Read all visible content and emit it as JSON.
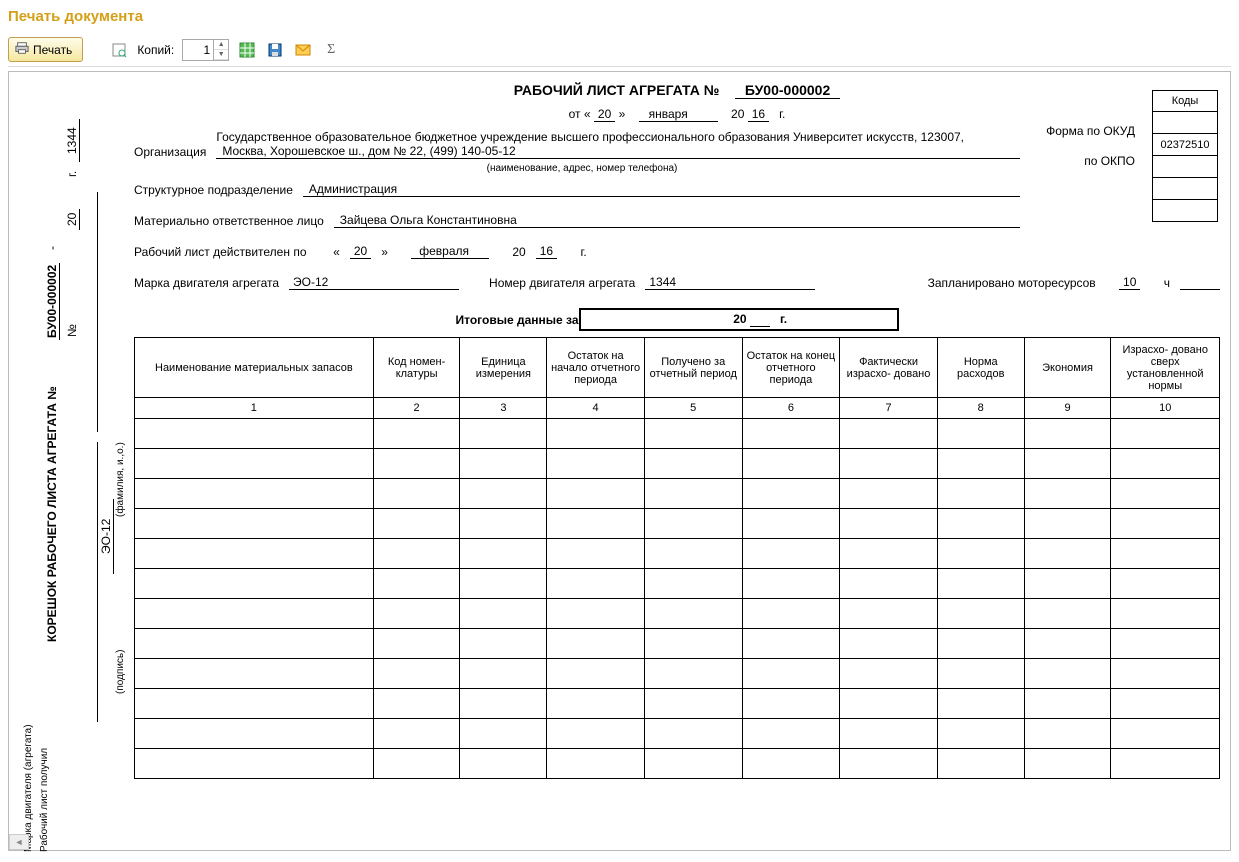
{
  "window": {
    "title": "Печать документа"
  },
  "toolbar": {
    "print_label": "Печать",
    "copies_label": "Копий:",
    "copies_value": "1"
  },
  "doc": {
    "title_prefix": "РАБОЧИЙ  ЛИСТ АГРЕГАТА  №",
    "number": "БУ00-000002",
    "date": {
      "from_prefix": "от  «",
      "day": "20",
      "mid1": "»",
      "month": "января",
      "year_prefix": "20",
      "year": "16",
      "suffix": "г."
    },
    "codes": {
      "header": "Коды",
      "okud_label": "Форма по ОКУД",
      "okud_value": "",
      "okpo_label": "по ОКПО",
      "okpo_value": "02372510"
    },
    "org_label": "Организация",
    "org_value1": "Государственное образовательное бюджетное учреждение высшего профессионального образования  Университет искусств, 123007,",
    "org_value2": "Москва, Хорошевское ш., дом № 22, (499) 140-05-12",
    "org_caption": "(наименование, адрес, номер телефона)",
    "dept_label": "Структурное подразделение",
    "dept_value": "Администрация",
    "person_label": "Материально ответственное лицо",
    "person_value": "Зайцева Ольга Константиновна",
    "valid_label": "Рабочий лист действителен по",
    "valid": {
      "d1": "«",
      "day": "20",
      "d2": "»",
      "month": "февраля",
      "yp": "20",
      "year": "16",
      "suffix": "г."
    },
    "engine_brand_label": "Марка двигателя агрегата",
    "engine_brand": "ЭО-12",
    "engine_num_label": "Номер двигателя агрегата",
    "engine_num": "1344",
    "plan_label": "Запланировано моторесурсов",
    "plan_value": "10",
    "plan_unit": "ч",
    "summary_label": "Итоговые данные за",
    "summary_year_prefix": "20",
    "summary_year_suffix": "г.",
    "table": {
      "headers": [
        "Наименование материальных запасов",
        "Код номен-\nклатуры",
        "Единица измерения",
        "Остаток на начало отчетного периода",
        "Получено за отчетный период",
        "Остаток на конец отчетного периода",
        "Фактически израсхо-\nдовано",
        "Норма расходов",
        "Экономия",
        "Израсхо-\nдовано сверх установленной нормы"
      ],
      "numbers": [
        "1",
        "2",
        "3",
        "4",
        "5",
        "6",
        "7",
        "8",
        "9",
        "10"
      ],
      "empty_rows": 12
    }
  },
  "stub": {
    "title": "КОРЕШОК  РАБОЧЕГО  ЛИСТА  АГРЕГАТА  №",
    "number": "БУ00-000002",
    "quote": "\"",
    "no_label": "№",
    "year_prefix": "20",
    "suffix": "г.",
    "engine_brand": "ЭО-12",
    "engine_num": "1344",
    "fio_caption": "(фамилия, и.,о.)",
    "sign_caption": "(подпись)",
    "brand_caption": "Марка двигателя (агрегата)",
    "received_caption": "Рабочий лист получил"
  }
}
